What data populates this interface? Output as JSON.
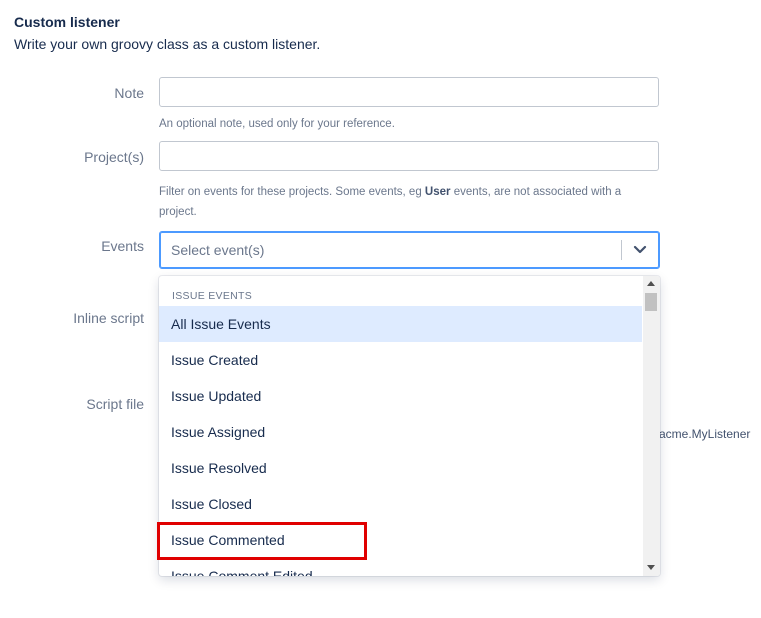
{
  "section": {
    "title": "Custom listener",
    "subtitle": "Write your own groovy class as a custom listener."
  },
  "form": {
    "note_label": "Note",
    "note_help": "An optional note, used only for your reference.",
    "projects_label": "Project(s)",
    "projects_help_pre": "Filter on events for these projects. Some events, eg ",
    "projects_help_bold": "User",
    "projects_help_post": " events, are not associated with a project.",
    "events_label": "Events",
    "events_placeholder": "Select event(s)",
    "inline_script_label": "Inline script",
    "script_file_label": "Script file",
    "script_file_hint": "acme.MyListener"
  },
  "dropdown": {
    "group_label": "ISSUE EVENTS",
    "options": [
      {
        "label": "All Issue Events",
        "selected": true
      },
      {
        "label": "Issue Created",
        "selected": false
      },
      {
        "label": "Issue Updated",
        "selected": false
      },
      {
        "label": "Issue Assigned",
        "selected": false
      },
      {
        "label": "Issue Resolved",
        "selected": false
      },
      {
        "label": "Issue Closed",
        "selected": false
      },
      {
        "label": "Issue Commented",
        "selected": false
      },
      {
        "label": "Issue Comment Edited",
        "selected": false
      }
    ],
    "highlighted_option": "Issue Commented"
  },
  "colors": {
    "focus_border": "#4c9aff",
    "selected_option_bg": "#deebff",
    "highlight_box": "#e00000"
  }
}
